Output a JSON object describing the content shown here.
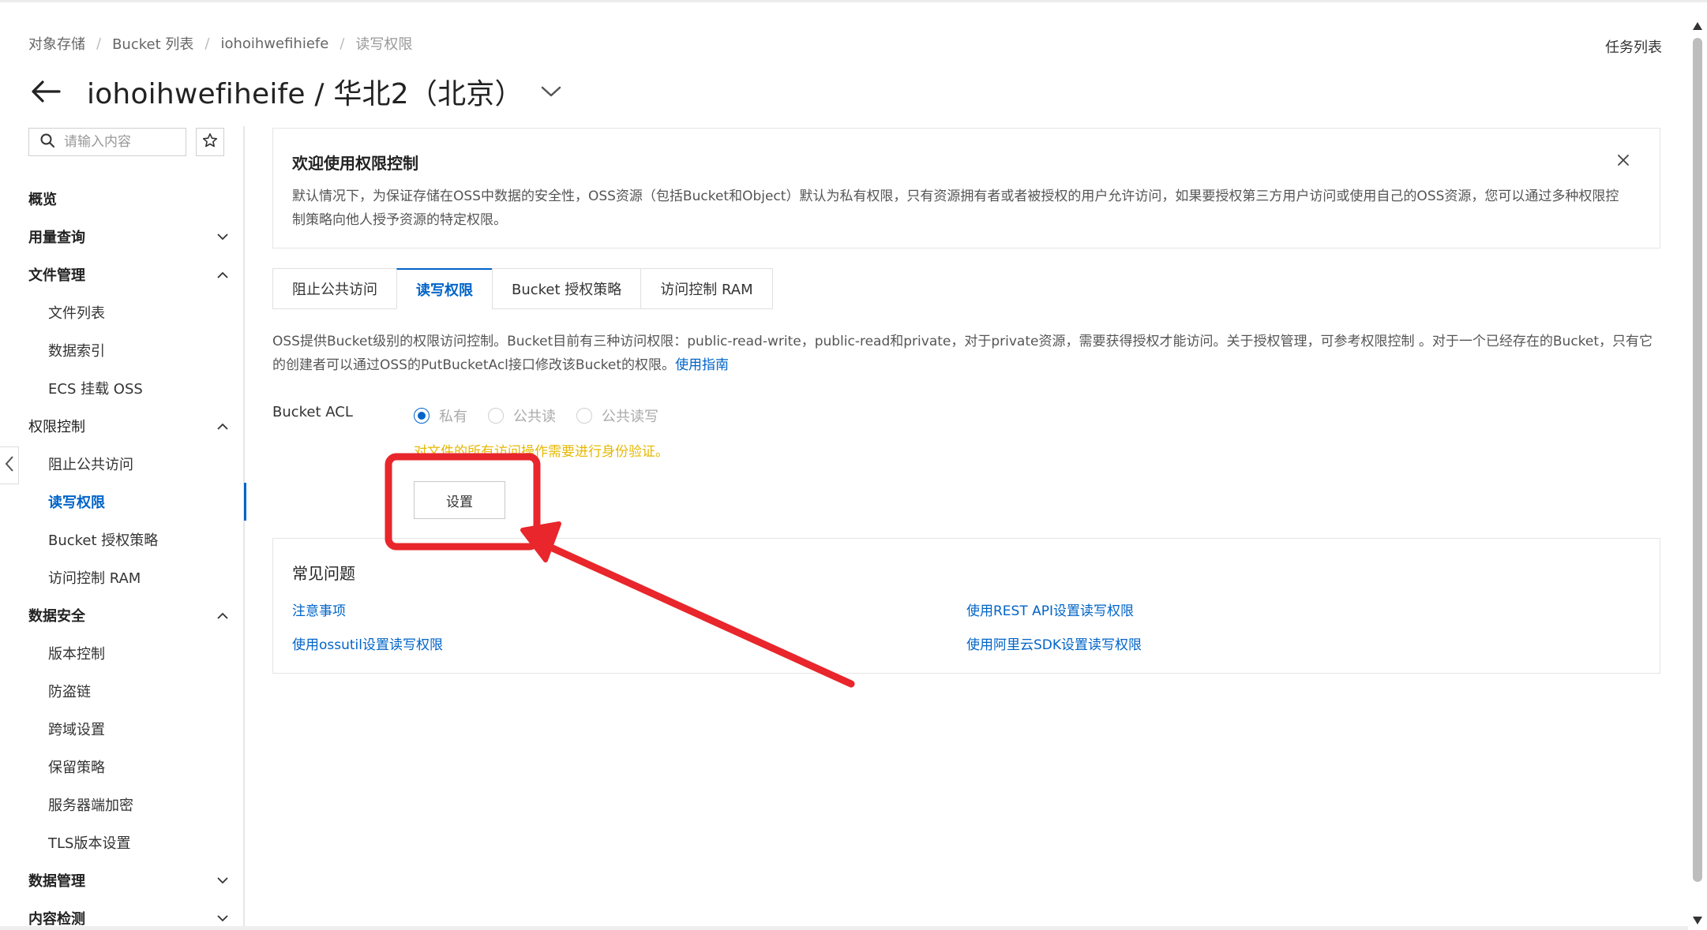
{
  "breadcrumb": [
    "对象存储",
    "Bucket 列表",
    "iohoihwefihiefe",
    "读写权限"
  ],
  "task_list": "任务列表",
  "page_title": "iohoihwefiheife / 华北2（北京）",
  "search": {
    "placeholder": "请输入内容"
  },
  "nav": {
    "overview": "概览",
    "usage": "用量查询",
    "file_mgmt": "文件管理",
    "file_list": "文件列表",
    "data_index": "数据索引",
    "ecs_mount": "ECS 挂载 OSS",
    "perm_ctrl": "权限控制",
    "block_public": "阻止公共访问",
    "rw_perm": "读写权限",
    "bucket_policy": "Bucket 授权策略",
    "ram": "访问控制 RAM",
    "data_security": "数据安全",
    "versioning": "版本控制",
    "hotlink": "防盗链",
    "cors": "跨域设置",
    "retention": "保留策略",
    "encryption": "服务器端加密",
    "tls": "TLS版本设置",
    "data_mgmt": "数据管理",
    "content_detect": "内容检测"
  },
  "welcome": {
    "title": "欢迎使用权限控制",
    "text": "默认情况下，为保证存储在OSS中数据的安全性，OSS资源（包括Bucket和Object）默认为私有权限，只有资源拥有者或者被授权的用户允许访问，如果要授权第三方用户访问或使用自己的OSS资源，您可以通过多种权限控制策略向他人授予资源的特定权限。"
  },
  "tabs": [
    "阻止公共访问",
    "读写权限",
    "Bucket 授权策略",
    "访问控制 RAM"
  ],
  "description": {
    "text": "OSS提供Bucket级别的权限访问控制。Bucket目前有三种访问权限：public-read-write，public-read和private，对于private资源，需要获得授权才能访问。关于授权管理，可参考权限控制 。对于一个已经存在的Bucket，只有它的创建者可以通过OSS的PutBucketAcl接口修改该Bucket的权限。",
    "link": "使用指南"
  },
  "acl": {
    "label": "Bucket ACL",
    "options": [
      "私有",
      "公共读",
      "公共读写"
    ],
    "selected": "私有",
    "hint": "对文件的所有访问操作需要进行身份验证。",
    "set_button": "设置"
  },
  "faq": {
    "title": "常见问题",
    "links": [
      "注意事项",
      "使用REST API设置读写权限",
      "使用ossutil设置读写权限",
      "使用阿里云SDK设置读写权限"
    ]
  },
  "colors": {
    "accent": "#0064c8",
    "annotation": "#e8262b",
    "hint": "#e6b800"
  }
}
